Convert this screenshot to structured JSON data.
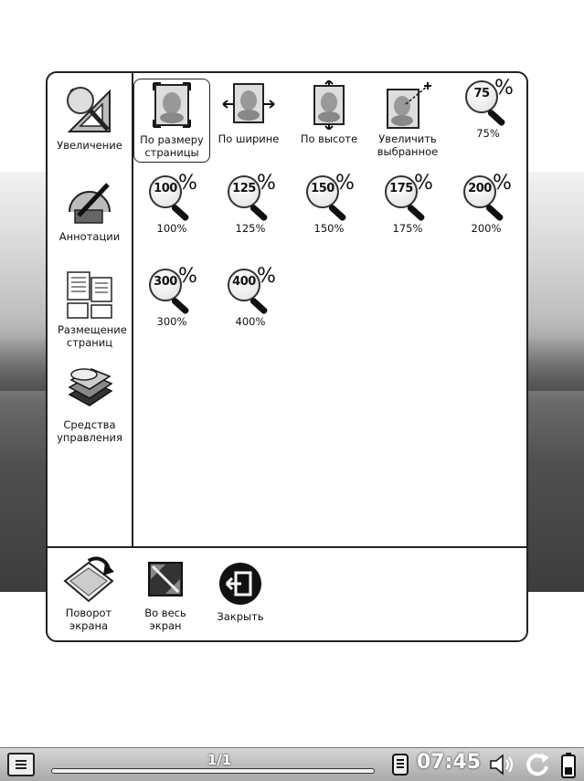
{
  "sidebar": {
    "items": [
      {
        "label": "Увеличение",
        "icon": "magnify-ruler-icon"
      },
      {
        "label": "Аннотации",
        "icon": "pen-annotation-icon"
      },
      {
        "label": "Размещение страниц",
        "icon": "page-layout-icon"
      },
      {
        "label": "Средства управления",
        "icon": "tools-books-icon"
      }
    ]
  },
  "zoom": {
    "modes": [
      {
        "label": "По размеру страницы",
        "icon": "fit-page-icon",
        "selected": true
      },
      {
        "label": "По ширине",
        "icon": "fit-width-icon"
      },
      {
        "label": "По высоте",
        "icon": "fit-height-icon"
      },
      {
        "label": "Увеличить выбранное",
        "icon": "zoom-selection-icon"
      }
    ],
    "levels": [
      {
        "num": "75",
        "pct": "%",
        "label": "75%"
      },
      {
        "num": "100",
        "pct": "%",
        "label": "100%"
      },
      {
        "num": "125",
        "pct": "%",
        "label": "125%"
      },
      {
        "num": "150",
        "pct": "%",
        "label": "150%"
      },
      {
        "num": "175",
        "pct": "%",
        "label": "175%"
      },
      {
        "num": "200",
        "pct": "%",
        "label": "200%"
      },
      {
        "num": "300",
        "pct": "%",
        "label": "300%"
      },
      {
        "num": "400",
        "pct": "%",
        "label": "400%"
      }
    ]
  },
  "bottom": {
    "rotate": "Поворот экрана",
    "fullscreen": "Во весь экран",
    "close": "Закрыть"
  },
  "statusbar": {
    "page": "1/1",
    "time": "07:45",
    "icons": [
      "menu-icon",
      "memory-card-icon",
      "volume-icon",
      "refresh-icon",
      "battery-icon"
    ]
  }
}
